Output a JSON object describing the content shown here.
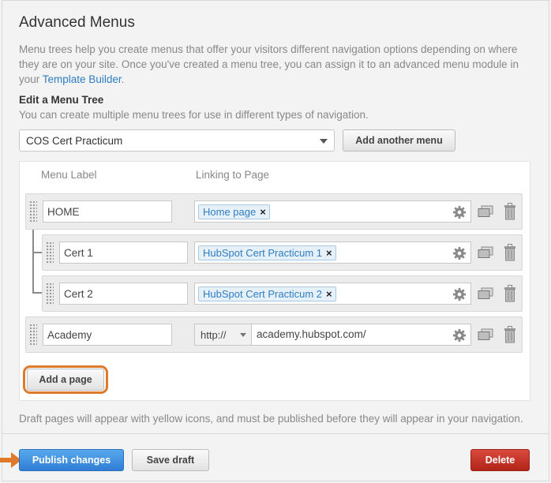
{
  "title": "Advanced Menus",
  "description": {
    "text": "Menu trees help you create menus that offer your visitors different navigation options depending on where they are on your site. Once you've created a menu tree, you can assign it to an advanced menu module in your ",
    "link": "Template Builder",
    "end": "."
  },
  "edit_tree": {
    "heading": "Edit a Menu Tree",
    "subtext": "You can create multiple menu trees for use in different types of navigation.",
    "selected_tree": "COS Cert Practicum",
    "add_menu_label": "Add another menu"
  },
  "columns": {
    "menu_label": "Menu Label",
    "linking_to_page": "Linking to Page"
  },
  "rows": [
    {
      "label": "HOME",
      "link_page": "Home page"
    },
    {
      "label": "Cert 1",
      "link_page": "HubSpot Cert Practicum 1"
    },
    {
      "label": "Cert 2",
      "link_page": "HubSpot Cert Practicum 2"
    },
    {
      "label": "Academy",
      "url_prefix": "http://",
      "url": "academy.hubspot.com/"
    }
  ],
  "remove_glyph": "×",
  "add_page_label": "Add a page",
  "footnote": "Draft pages will appear with yellow icons, and must be published before they will appear in your navigation.",
  "footer": {
    "publish_label": "Publish changes",
    "save_draft_label": "Save draft",
    "delete_label": "Delete"
  },
  "colors": {
    "accent_blue": "#2f7dd6",
    "highlight_orange": "#e07a2b",
    "delete_red": "#c0392b"
  },
  "icons": [
    "drag-handle-icon",
    "gear-icon",
    "copy-icon",
    "trash-icon",
    "arrow-icon"
  ]
}
